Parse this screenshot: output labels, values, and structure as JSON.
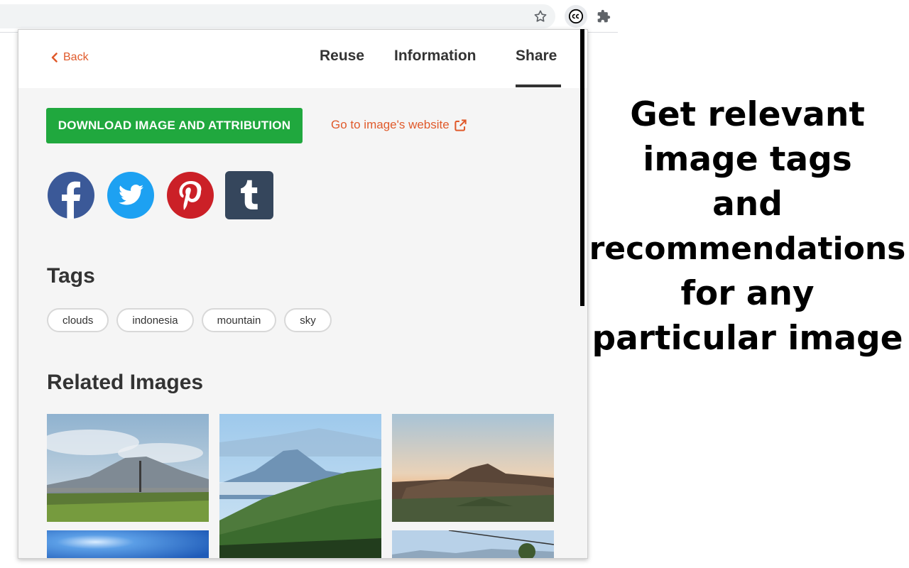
{
  "header": {
    "back_label": "Back",
    "tabs": [
      {
        "label": "Reuse"
      },
      {
        "label": "Information"
      },
      {
        "label": "Share"
      }
    ],
    "active_tab": "Share"
  },
  "actions": {
    "download_label": "DOWNLOAD IMAGE AND ATTRIBUTION",
    "website_label": "Go to image's website"
  },
  "share": {
    "networks": [
      "facebook",
      "twitter",
      "pinterest",
      "tumblr"
    ]
  },
  "tags": {
    "title": "Tags",
    "items": [
      "clouds",
      "indonesia",
      "mountain",
      "sky"
    ]
  },
  "related": {
    "title": "Related Images"
  },
  "promo": {
    "lines": [
      "Get relevant",
      "image tags",
      "and",
      "recommendations",
      "for any",
      "particular image"
    ]
  },
  "colors": {
    "accent": "#e05a2b",
    "download_green": "#20a83e",
    "facebook": "#3b5998",
    "twitter": "#1da1f2",
    "pinterest": "#cb2027",
    "tumblr": "#35465c"
  },
  "icons": {
    "toolbar": [
      "star-icon",
      "creative-commons-icon",
      "puzzle-icon"
    ],
    "back": "chevron-left-icon",
    "external": "external-link-icon"
  }
}
